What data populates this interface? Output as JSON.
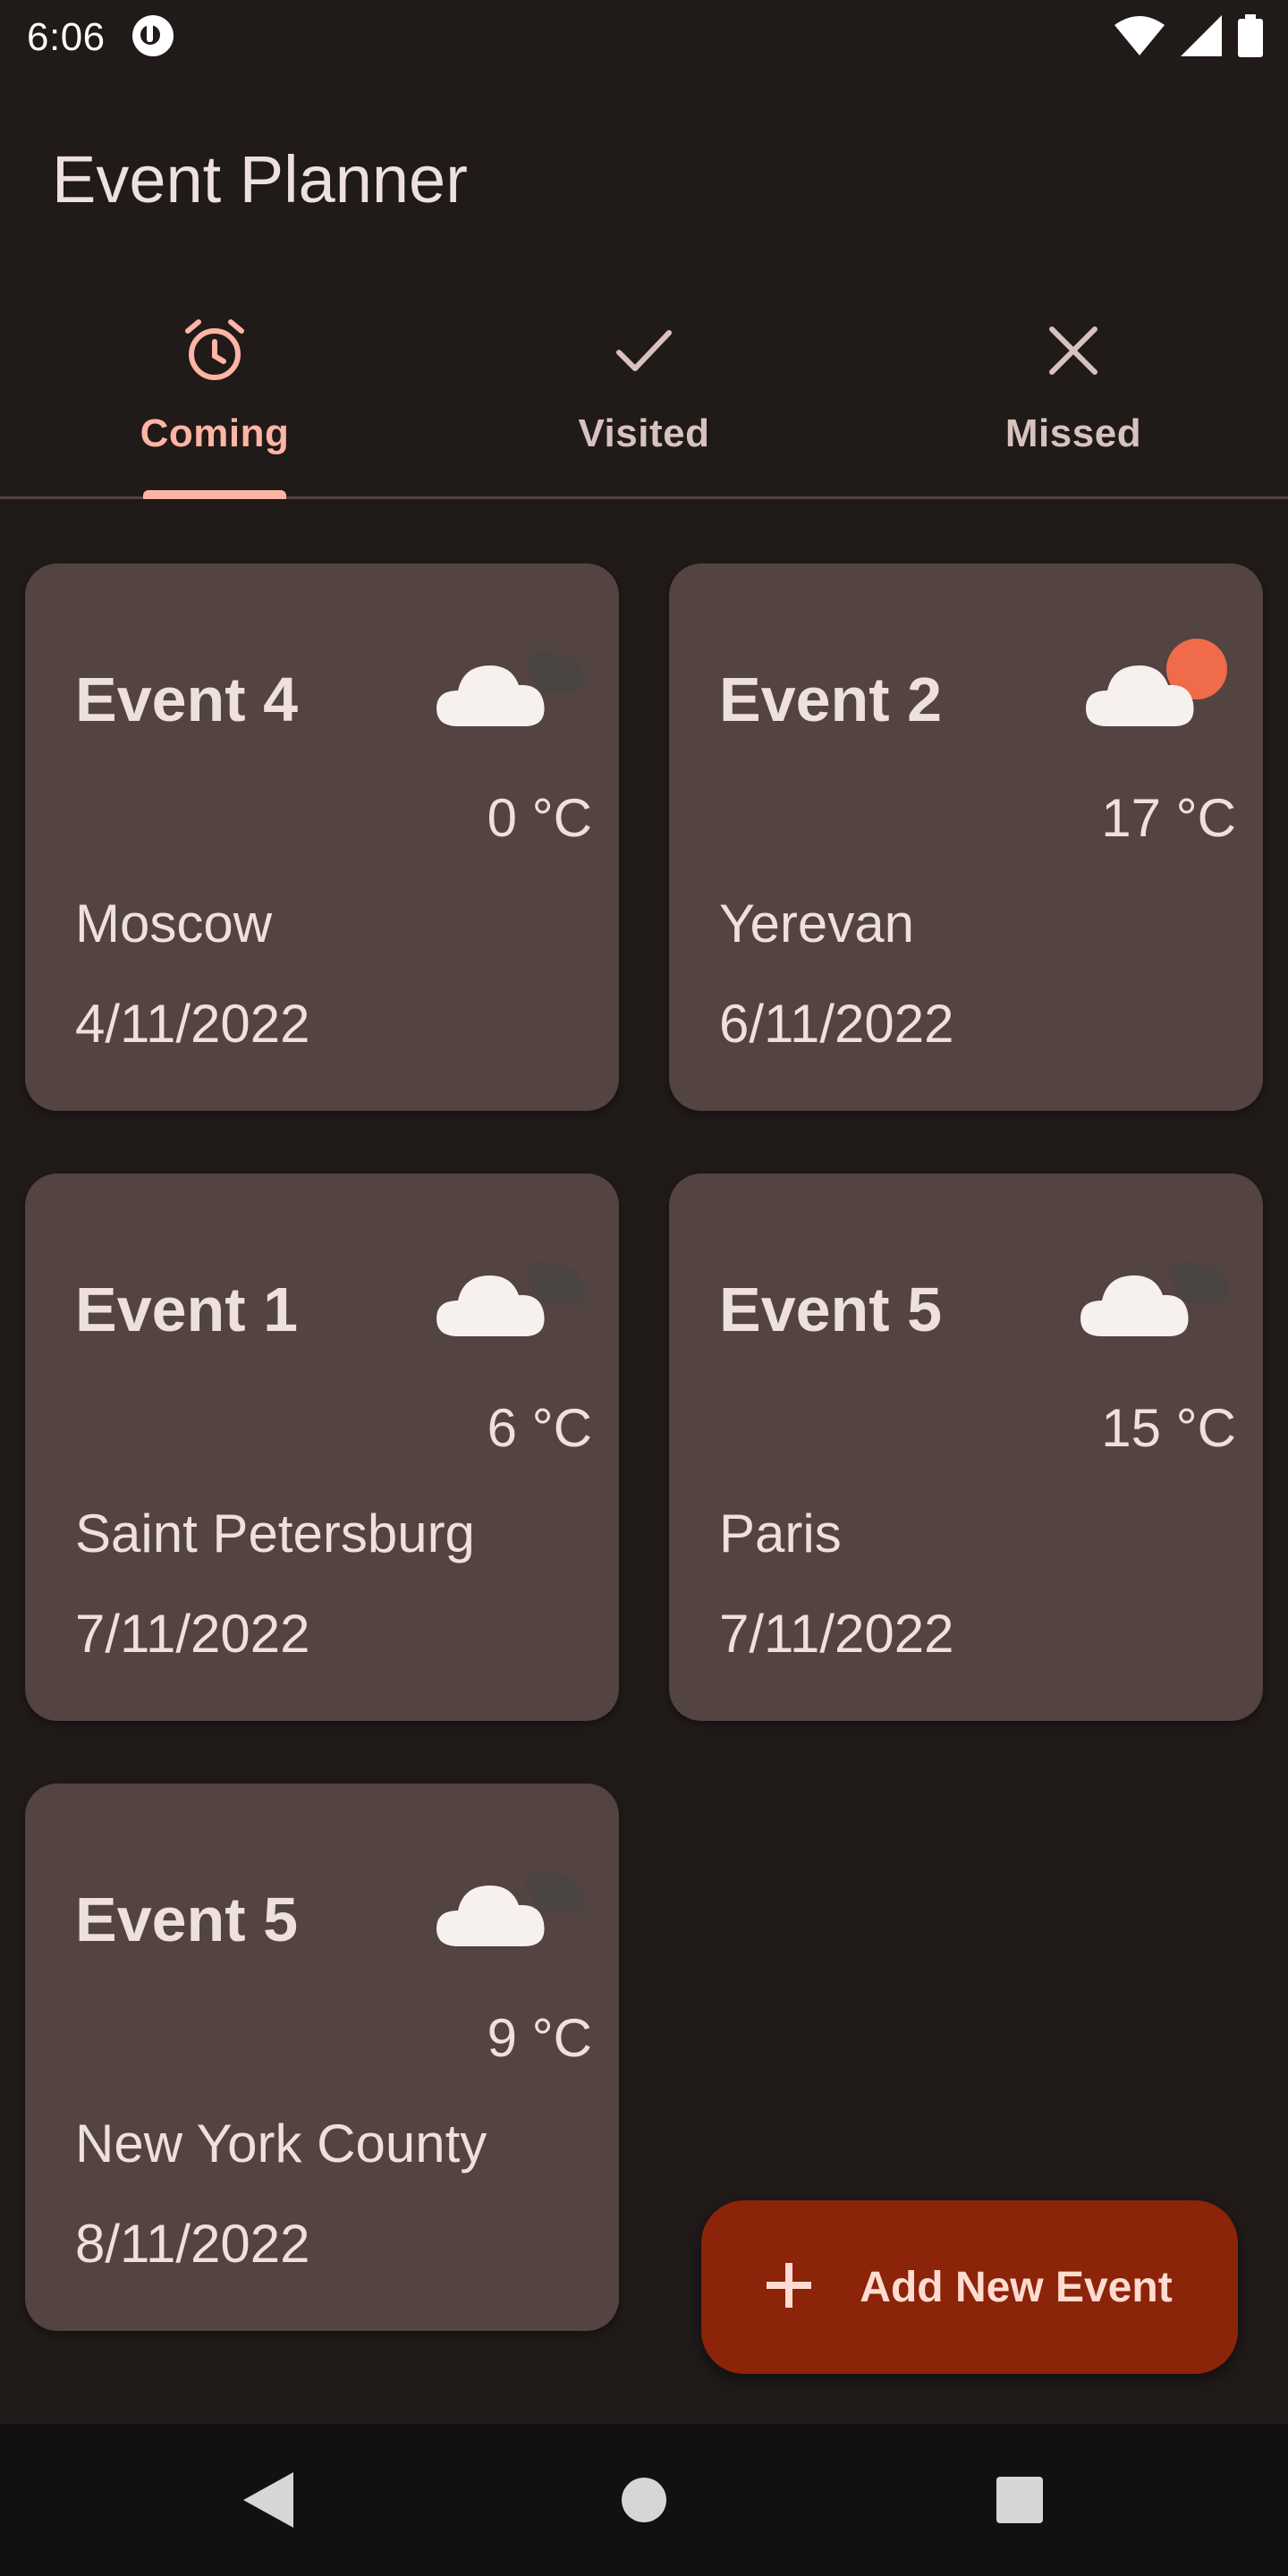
{
  "status_bar": {
    "time": "6:06"
  },
  "app": {
    "title": "Event Planner"
  },
  "tabs": [
    {
      "label": "Coming",
      "icon": "alarm-icon",
      "active": true
    },
    {
      "label": "Visited",
      "icon": "check-icon",
      "active": false
    },
    {
      "label": "Missed",
      "icon": "close-icon",
      "active": false
    }
  ],
  "events": [
    {
      "title": "Event 4",
      "temperature": "0 °C",
      "city": "Moscow",
      "date": "4/11/2022",
      "weather_icon": "cloudy-night-icon"
    },
    {
      "title": "Event 2",
      "temperature": "17 °C",
      "city": "Yerevan",
      "date": "6/11/2022",
      "weather_icon": "cloudy-sun-icon"
    },
    {
      "title": "Event 1",
      "temperature": "6 °C",
      "city": "Saint Petersburg",
      "date": "7/11/2022",
      "weather_icon": "cloudy-night-icon"
    },
    {
      "title": "Event 5",
      "temperature": "15 °C",
      "city": "Paris",
      "date": "7/11/2022",
      "weather_icon": "cloudy-night-icon"
    },
    {
      "title": "Event 5",
      "temperature": "9 °C",
      "city": "New York County",
      "date": "8/11/2022",
      "weather_icon": "cloudy-night-icon"
    }
  ],
  "fab": {
    "label": "Add New Event",
    "icon": "plus-icon"
  },
  "colors": {
    "background": "#201a19",
    "card": "#534341",
    "accent": "#ffb4a4",
    "fab": "#8b2409",
    "sun": "#f06b4a"
  }
}
